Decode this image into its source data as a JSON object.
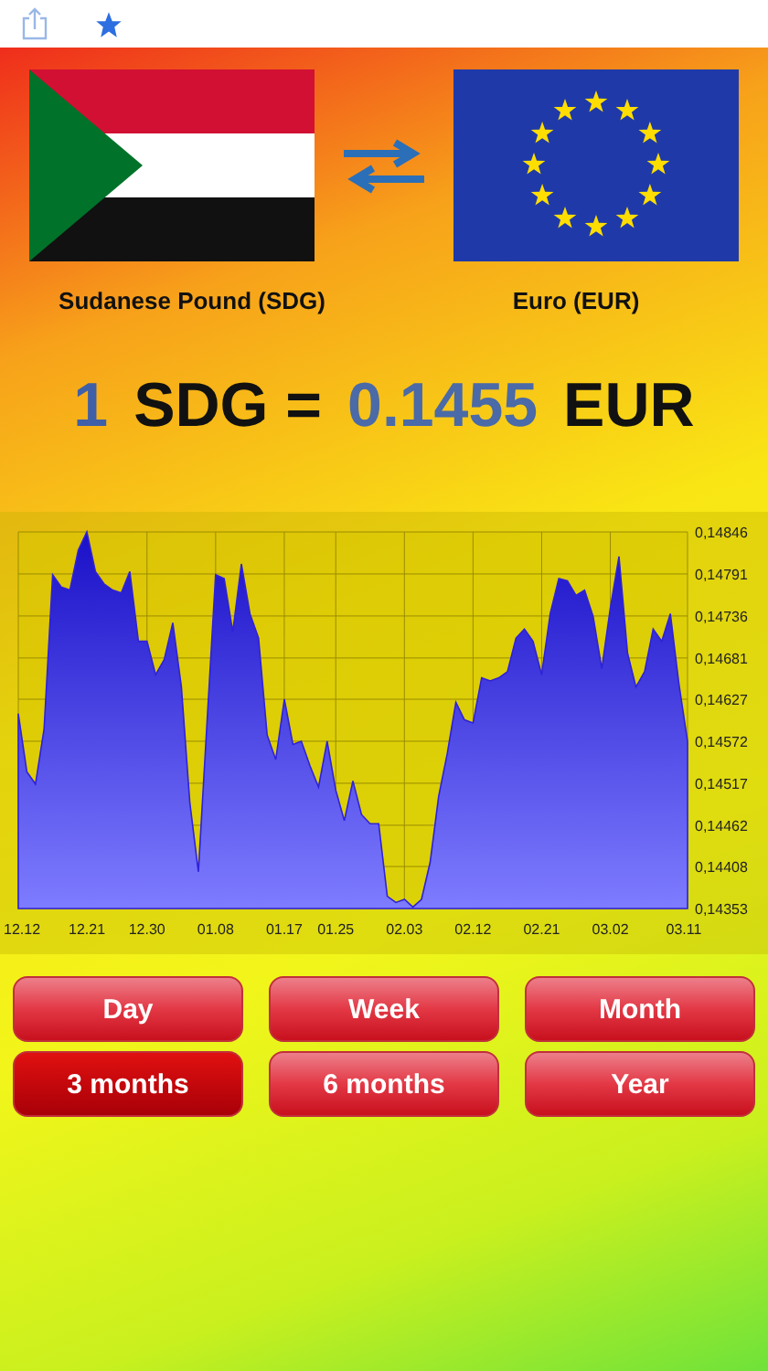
{
  "from_currency": {
    "label": "Sudanese Pound (SDG)"
  },
  "to_currency": {
    "label": "Euro (EUR)"
  },
  "rate": {
    "amount": "1",
    "from": "SDG =",
    "value": "0.1455",
    "to": "EUR"
  },
  "chart": {
    "chart_data": {
      "type": "area",
      "categories": [
        "12.12",
        null,
        null,
        null,
        null,
        null,
        null,
        null,
        "12.21",
        null,
        null,
        null,
        null,
        null,
        null,
        "12.30",
        null,
        null,
        null,
        null,
        null,
        null,
        null,
        "01.08",
        null,
        null,
        null,
        null,
        null,
        null,
        null,
        "01.17",
        null,
        null,
        null,
        null,
        null,
        "01.25",
        null,
        null,
        null,
        null,
        null,
        null,
        null,
        "02.03",
        null,
        null,
        null,
        null,
        null,
        null,
        null,
        "02.12",
        null,
        null,
        null,
        null,
        null,
        null,
        null,
        "02.21",
        null,
        null,
        null,
        null,
        null,
        null,
        null,
        "03.02",
        null,
        null,
        null,
        null,
        null,
        null,
        null,
        null,
        "03.11"
      ],
      "series": [
        {
          "color": "#2f22d8",
          "values": [
            0.14608,
            0.14532,
            0.14516,
            0.14588,
            0.1479,
            0.14774,
            0.1477,
            0.14822,
            0.14846,
            0.14794,
            0.14778,
            0.1477,
            0.14766,
            0.14794,
            0.14703,
            0.14703,
            0.14659,
            0.14679,
            0.14727,
            0.14643,
            0.14492,
            0.14401,
            0.14596,
            0.1479,
            0.14785,
            0.14715,
            0.14804,
            0.14739,
            0.14707,
            0.1458,
            0.14548,
            0.14627,
            0.14568,
            0.14572,
            0.1454,
            0.14512,
            0.14572,
            0.14508,
            0.14468,
            0.1452,
            0.14476,
            0.14464,
            0.14464,
            0.14369,
            0.14361,
            0.14365,
            0.14355,
            0.14365,
            0.14413,
            0.145,
            0.14556,
            0.14623,
            0.146,
            0.14596,
            0.14655,
            0.14651,
            0.14655,
            0.14663,
            0.14707,
            0.14719,
            0.14703,
            0.14659,
            0.14739,
            0.14785,
            0.14782,
            0.14763,
            0.1477,
            0.14735,
            0.14667,
            0.14747,
            0.14814,
            0.14687,
            0.14643,
            0.14663,
            0.14719,
            0.14703,
            0.14739,
            0.14647,
            0.14572
          ]
        }
      ],
      "grid": true,
      "ylim": [
        0.14353,
        0.14846
      ],
      "yticks": [
        {
          "value": 0.14846,
          "label": "0,14846"
        },
        {
          "value": 0.14791,
          "label": "0,14791"
        },
        {
          "value": 0.14736,
          "label": "0,14736"
        },
        {
          "value": 0.14681,
          "label": "0,14681"
        },
        {
          "value": 0.14627,
          "label": "0,14627"
        },
        {
          "value": 0.14572,
          "label": "0,14572"
        },
        {
          "value": 0.14517,
          "label": "0,14517"
        },
        {
          "value": 0.14462,
          "label": "0,14462"
        },
        {
          "value": 0.14408,
          "label": "0,14408"
        },
        {
          "value": 0.14353,
          "label": "0,14353"
        }
      ]
    }
  },
  "periods": [
    {
      "label": "Day",
      "selected": false
    },
    {
      "label": "Week",
      "selected": false
    },
    {
      "label": "Month",
      "selected": false
    },
    {
      "label": "3 months",
      "selected": true
    },
    {
      "label": "6 months",
      "selected": false
    },
    {
      "label": "Year",
      "selected": false
    }
  ]
}
